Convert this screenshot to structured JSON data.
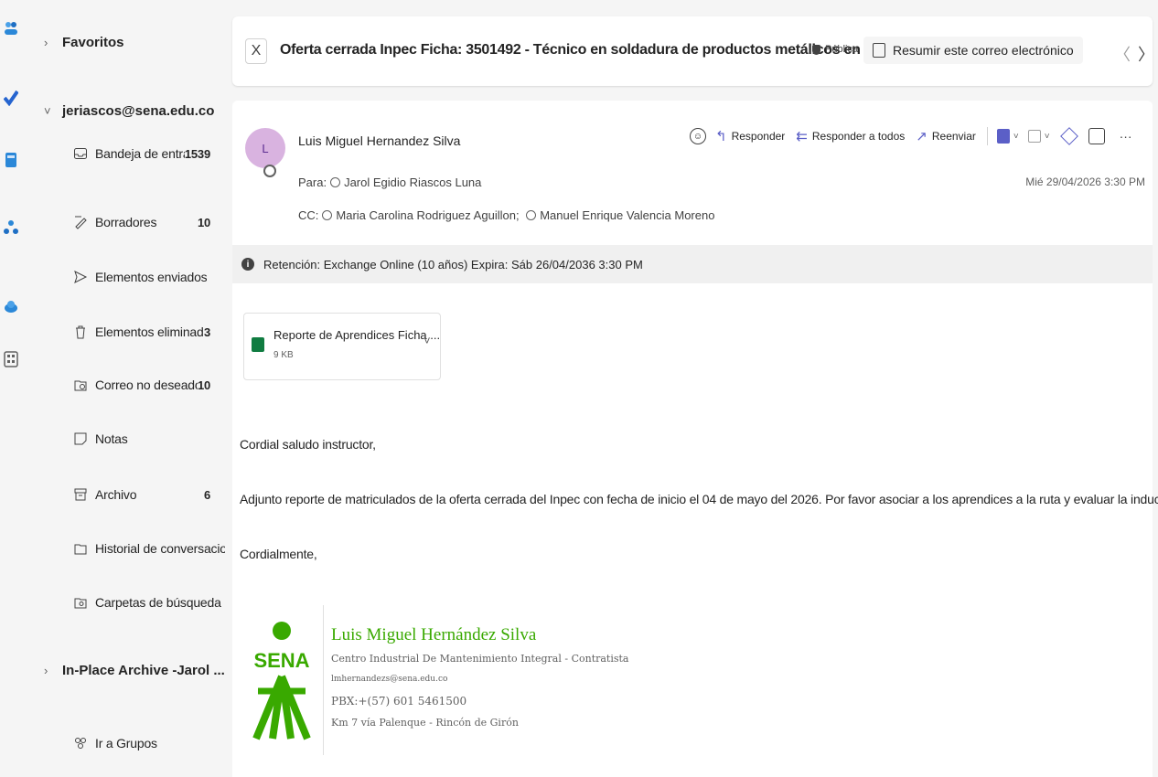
{
  "rail": {
    "apps": [
      "people-icon",
      "todo-icon",
      "files-icon",
      "org-icon",
      "onedrive-icon",
      "more-apps-icon"
    ]
  },
  "folders": {
    "favorites_label": "Favoritos",
    "account_label": "jeriascos@sena.edu.co",
    "items": [
      {
        "label": "Bandeja de entrada",
        "count": "1539",
        "icon": "inbox-icon"
      },
      {
        "label": "Borradores",
        "count": "10",
        "icon": "drafts-icon"
      },
      {
        "label": "Elementos enviados",
        "count": "",
        "icon": "sent-icon"
      },
      {
        "label": "Elementos eliminados",
        "count": "3",
        "icon": "trash-icon"
      },
      {
        "label": "Correo no deseado",
        "count": "10",
        "icon": "junk-icon"
      },
      {
        "label": "Notas",
        "count": "",
        "icon": "notes-icon"
      },
      {
        "label": "Archivo",
        "count": "6",
        "icon": "archive-icon"
      },
      {
        "label": "Historial de conversacio...",
        "count": "",
        "icon": "history-icon"
      },
      {
        "label": "Carpetas de búsqueda",
        "count": "",
        "icon": "search-folder-icon"
      }
    ],
    "archive_label": "In-Place Archive -Jarol ...",
    "groups_label": "Ir a Grupos"
  },
  "message": {
    "close_label": "X",
    "subject": "Oferta cerrada Inpec Ficha: 3501492 - Técnico en soldadura de productos metálicos en platina",
    "sensitivity": "Pública",
    "summarize_label": "Resumir este correo electrónico",
    "nav_prev": "〈",
    "nav_next": "〉",
    "avatar_initial": "L",
    "sender": "Luis Miguel Hernandez Silva",
    "to_label": "Para:",
    "to": "Jarol Egidio Riascos Luna",
    "cc_label": "CC:",
    "cc": [
      "Maria Carolina Rodriguez Aguillon;",
      "Manuel Enrique Valencia Moreno"
    ],
    "date": "Mié 29/04/2026 3:30 PM",
    "actions": {
      "reply": "Responder",
      "reply_all": "Responder a todos",
      "forward": "Reenviar",
      "more": "···"
    },
    "retention": "Retención: Exchange Online (10 años) Expira: Sáb 26/04/2036 3:30 PM",
    "attachment": {
      "name": "Reporte de Aprendices Ficha ...",
      "size": "9 KB"
    },
    "body": [
      "Cordial saludo instructor,",
      "Adjunto reporte de matriculados de la oferta cerrada del Inpec con fecha de inicio el 04 de mayo del 2026. Por favor asociar a los aprendices a la ruta y evaluar la inducción.",
      "Cordialmente,"
    ],
    "signature": {
      "logo_text": "SENA",
      "name": "Luis Miguel Hernández Silva",
      "org": "Centro Industrial De Mantenimiento Integral - Contratista",
      "email": "lmhernandezs@sena.edu.co",
      "phone": "PBX:+(57) 601 5461500",
      "address": "Km 7 vía Palenque - Rincón de Girón"
    }
  },
  "colors": {
    "accent": "#5b5fc7",
    "sena_green": "#39a900",
    "background": "#f5f5f5"
  }
}
